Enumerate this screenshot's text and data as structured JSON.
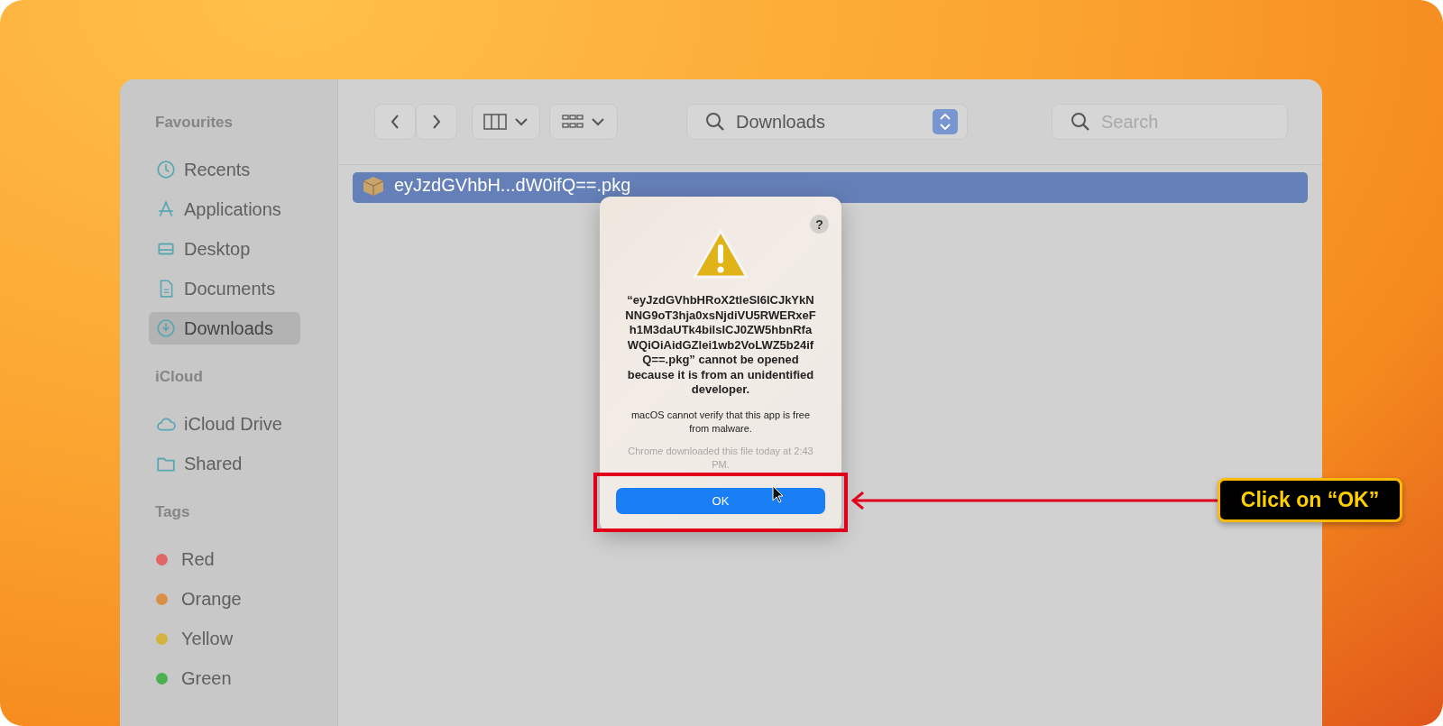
{
  "sidebar": {
    "sections": [
      {
        "heading": "Favourites",
        "items": [
          {
            "kind": "clock",
            "label": "Recents",
            "selected": false
          },
          {
            "kind": "apps",
            "label": "Applications",
            "selected": false
          },
          {
            "kind": "desktop",
            "label": "Desktop",
            "selected": false
          },
          {
            "kind": "document",
            "label": "Documents",
            "selected": false
          },
          {
            "kind": "download",
            "label": "Downloads",
            "selected": true
          }
        ]
      },
      {
        "heading": "iCloud",
        "items": [
          {
            "kind": "cloud",
            "label": "iCloud Drive",
            "selected": false
          },
          {
            "kind": "folder",
            "label": "Shared",
            "selected": false
          }
        ]
      },
      {
        "heading": "Tags",
        "items": [
          {
            "kind": "tag",
            "label": "Red",
            "color": "#e06666",
            "selected": false
          },
          {
            "kind": "tag",
            "label": "Orange",
            "color": "#d89048",
            "selected": false
          },
          {
            "kind": "tag",
            "label": "Yellow",
            "color": "#d4b440",
            "selected": false
          },
          {
            "kind": "tag",
            "label": "Green",
            "color": "#4caf50",
            "selected": false
          }
        ]
      }
    ]
  },
  "toolbar": {
    "path_control": "Downloads",
    "search": {
      "placeholder": "Search"
    }
  },
  "files": [
    {
      "name": "eyJzdGVhbH...dW0ifQ==.pkg",
      "selected": true
    }
  ],
  "dialog": {
    "help_button": "?",
    "title": "“eyJzdGVhbHRoX2tleSI6ICJkYkNNNG9oT3hja0xsNjdiVU5RWERxeFh1M3daUTk4bilsICJ0ZW5hbnRfaWQiOiAidGZlei1wb2VoLWZ5b24ifQ==.pkg” cannot be opened because it is from an unidentified developer.",
    "message": "macOS cannot verify that this app is free from malware.",
    "note": "Chrome downloaded this file today at 2:43 PM.",
    "button": "OK"
  },
  "annotation": {
    "callout": "Click on “OK”"
  }
}
